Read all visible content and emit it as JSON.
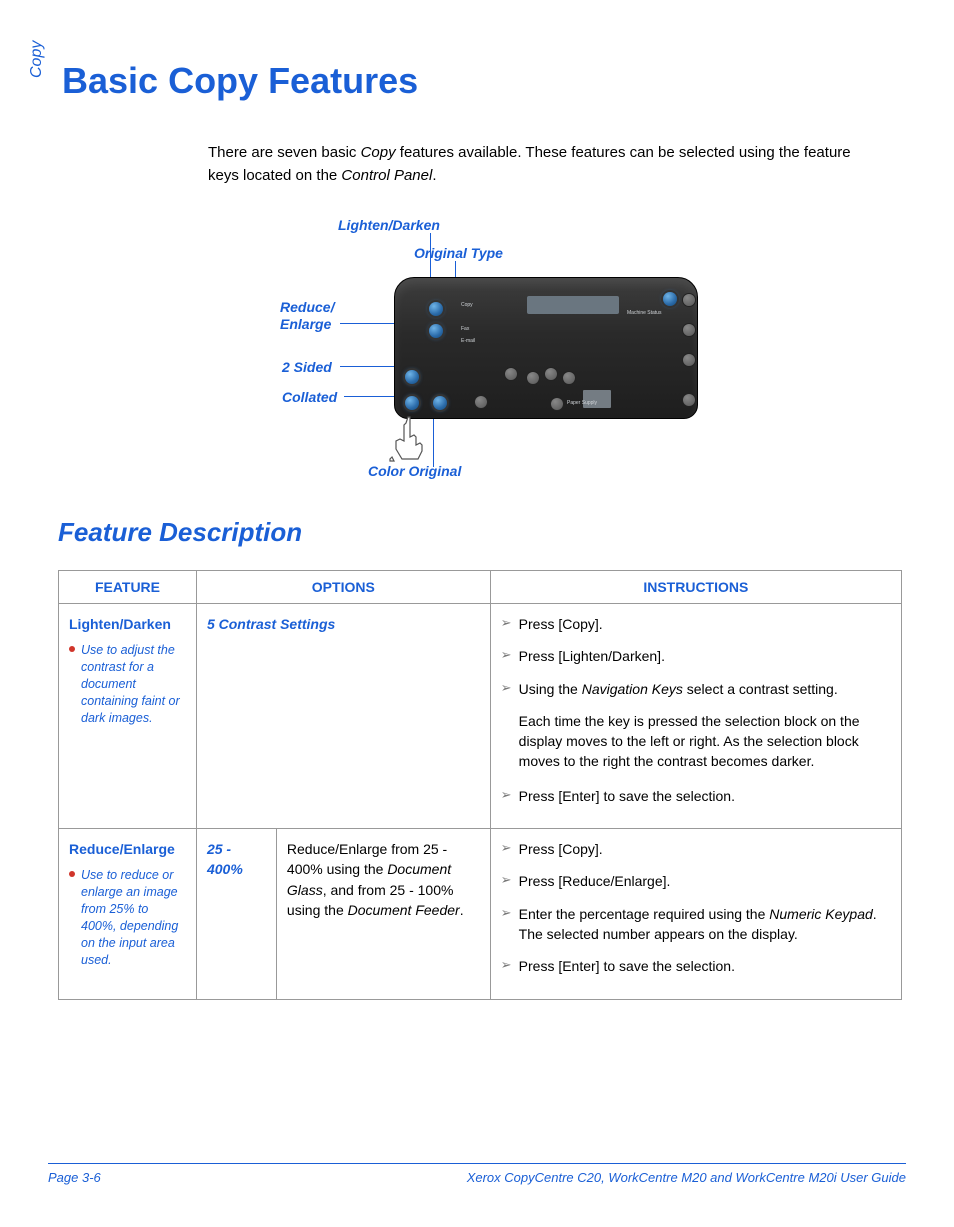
{
  "side_tab": "Copy",
  "title": "Basic Copy Features",
  "lead": {
    "pre": "There are seven basic ",
    "copy": "Copy",
    "mid": " features available. These features can be selected using the feature keys located on the ",
    "cp": "Control Panel",
    "post": "."
  },
  "figure_labels": {
    "lighten_darken": "Lighten/Darken",
    "original_type": "Original Type",
    "reduce_enlarge_a": "Reduce/",
    "reduce_enlarge_b": "Enlarge",
    "two_sided": "2 Sided",
    "collated": "Collated",
    "color_original": "Color Original"
  },
  "subhead": "Feature Description",
  "table": {
    "headers": {
      "feature": "FEATURE",
      "options": "OPTIONS",
      "instructions": "INSTRUCTIONS"
    },
    "rows": [
      {
        "feature": {
          "name": "Lighten/Darken",
          "desc": "Use to adjust the contrast for a document containing faint or dark images."
        },
        "option_label": "5 Contrast Settings",
        "option_text": "",
        "instructions": {
          "steps": [
            {
              "t": "Press [Copy]."
            },
            {
              "t": "Press [Lighten/Darken]."
            },
            {
              "pre": "Using the ",
              "it": "Navigation Keys",
              "post": " select a contrast setting."
            }
          ],
          "note": "Each time the key is pressed the selection block on the display moves to the left or right. As the selection block moves to the right the contrast becomes darker.",
          "final": "Press [Enter] to save the selection."
        }
      },
      {
        "feature": {
          "name": "Reduce/Enlarge",
          "desc": "Use to reduce or enlarge an image from 25% to 400%, depending on the input area used."
        },
        "option_label": "25  - 400%",
        "option_text": {
          "a": "Reduce/Enlarge from 25 - 400% using the ",
          "it1": "Document Glass",
          "b": ", and from 25 - 100% using the ",
          "it2": "Document Feeder",
          "c": "."
        },
        "instructions": {
          "steps": [
            {
              "t": "Press [Copy]."
            },
            {
              "t": "Press [Reduce/Enlarge]."
            },
            {
              "pre": "Enter the percentage required using the ",
              "it": "Numeric Keypad",
              "post": ". The selected number appears on the display."
            }
          ],
          "final": "Press [Enter] to save the selection."
        }
      }
    ]
  },
  "chart_data": {
    "type": "table",
    "title": "Feature Description",
    "columns": [
      "FEATURE",
      "OPTIONS",
      "INSTRUCTIONS"
    ],
    "rows": [
      {
        "feature": "Lighten/Darken — Use to adjust the contrast for a document containing faint or dark images.",
        "options": "5 Contrast Settings",
        "instructions": "Press [Copy]. Press [Lighten/Darken]. Using the Navigation Keys select a contrast setting. Each time the key is pressed the selection block on the display moves to the left or right. As the selection block moves to the right the contrast becomes darker. Press [Enter] to save the selection."
      },
      {
        "feature": "Reduce/Enlarge — Use to reduce or enlarge an image from 25% to 400%, depending on the input area used.",
        "options": "25 - 400%: Reduce/Enlarge from 25 - 400% using the Document Glass, and from 25 - 100% using the Document Feeder.",
        "instructions": "Press [Copy]. Press [Reduce/Enlarge]. Enter the percentage required using the Numeric Keypad. The selected number appears on the display. Press [Enter] to save the selection."
      }
    ]
  },
  "footer": {
    "page": "Page 3-6",
    "doc": "Xerox CopyCentre C20, WorkCentre M20 and WorkCentre M20i User Guide"
  }
}
